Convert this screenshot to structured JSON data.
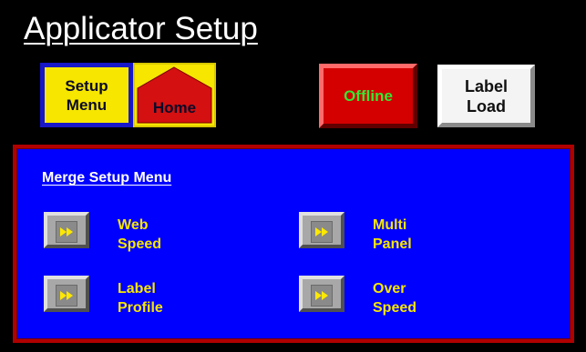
{
  "header": {
    "title": "Applicator Setup"
  },
  "toolbar": {
    "setup_menu_label": "Setup\nMenu",
    "home_label": "Home",
    "offline_label": "Offline",
    "label_load_label": "Label\nLoad"
  },
  "panel": {
    "title": "Merge Setup Menu",
    "items": [
      {
        "label": "Web\nSpeed",
        "icon": "fast-forward-icon"
      },
      {
        "label": "Multi\nPanel",
        "icon": "fast-forward-icon"
      },
      {
        "label": "Label\nProfile",
        "icon": "fast-forward-icon"
      },
      {
        "label": "Over\nSpeed",
        "icon": "fast-forward-icon"
      }
    ]
  },
  "colors": {
    "background": "#000000",
    "panel": "#0000ff",
    "panel_border": "#b00000",
    "accent_yellow": "#f6e600",
    "offline_red": "#d40000",
    "offline_text": "#33e833"
  }
}
